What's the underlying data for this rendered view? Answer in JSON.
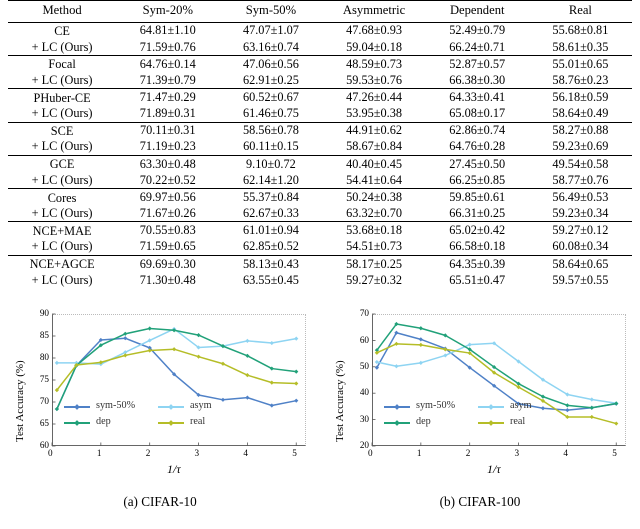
{
  "table": {
    "headers": [
      "Method",
      "Sym-20%",
      "Sym-50%",
      "Asymmetric",
      "Dependent",
      "Real"
    ],
    "groups": [
      {
        "base": {
          "method": "CE",
          "cells": [
            "64.81±1.10",
            "47.07±1.07",
            "47.68±0.93",
            "52.49±0.79",
            "55.68±0.81"
          ],
          "bold": [
            false,
            false,
            false,
            false,
            false
          ]
        },
        "ours": {
          "method": "+ LC (Ours)",
          "cells": [
            "71.59±0.76",
            "63.16±0.74",
            "59.04±0.18",
            "66.24±0.71",
            "58.61±0.35"
          ],
          "bold": [
            true,
            true,
            true,
            true,
            true
          ]
        }
      },
      {
        "base": {
          "method": "Focal",
          "cells": [
            "64.76±0.14",
            "47.06±0.56",
            "48.59±0.73",
            "52.87±0.57",
            "55.01±0.65"
          ],
          "bold": [
            false,
            false,
            false,
            false,
            false
          ]
        },
        "ours": {
          "method": "+ LC (Ours)",
          "cells": [
            "71.39±0.79",
            "62.91±0.25",
            "59.53±0.76",
            "66.38±0.30",
            "58.76±0.23"
          ],
          "bold": [
            true,
            true,
            true,
            true,
            true
          ]
        }
      },
      {
        "base": {
          "method": "PHuber-CE",
          "cells": [
            "71.47±0.29",
            "60.52±0.67",
            "47.26±0.44",
            "64.33±0.41",
            "56.18±0.59"
          ],
          "bold": [
            false,
            false,
            false,
            false,
            false
          ]
        },
        "ours": {
          "method": "+ LC (Ours)",
          "cells": [
            "71.89±0.31",
            "61.46±0.75",
            "53.95±0.38",
            "65.08±0.17",
            "58.64±0.49"
          ],
          "bold": [
            false,
            true,
            true,
            true,
            true
          ]
        }
      },
      {
        "base": {
          "method": "SCE",
          "cells": [
            "70.11±0.31",
            "58.56±0.78",
            "44.91±0.62",
            "62.86±0.74",
            "58.27±0.88"
          ],
          "bold": [
            false,
            false,
            false,
            false,
            false
          ]
        },
        "ours": {
          "method": "+ LC (Ours)",
          "cells": [
            "71.19±0.23",
            "60.11±0.15",
            "58.67±0.84",
            "64.76±0.28",
            "59.23±0.69"
          ],
          "bold": [
            true,
            true,
            true,
            true,
            true
          ]
        }
      },
      {
        "base": {
          "method": "GCE",
          "cells": [
            "63.30±0.48",
            "9.10±0.72",
            "40.40±0.45",
            "27.45±0.50",
            "49.54±0.58"
          ],
          "bold": [
            false,
            false,
            false,
            false,
            false
          ]
        },
        "ours": {
          "method": "+ LC (Ours)",
          "cells": [
            "70.22±0.52",
            "62.14±1.20",
            "54.41±0.64",
            "66.25±0.85",
            "58.77±0.76"
          ],
          "bold": [
            true,
            true,
            true,
            true,
            true
          ]
        }
      },
      {
        "base": {
          "method": "Cores",
          "cells": [
            "69.97±0.56",
            "55.37±0.84",
            "50.24±0.38",
            "59.85±0.61",
            "56.49±0.53"
          ],
          "bold": [
            false,
            false,
            false,
            false,
            false
          ]
        },
        "ours": {
          "method": "+ LC (Ours)",
          "cells": [
            "71.67±0.26",
            "62.67±0.33",
            "63.32±0.70",
            "66.31±0.25",
            "59.23±0.34"
          ],
          "bold": [
            true,
            true,
            true,
            true,
            true
          ]
        }
      },
      {
        "base": {
          "method": "NCE+MAE",
          "cells": [
            "70.55±0.83",
            "61.01±0.94",
            "53.68±0.18",
            "65.02±0.42",
            "59.27±0.12"
          ],
          "bold": [
            false,
            false,
            false,
            false,
            false
          ]
        },
        "ours": {
          "method": "+ LC (Ours)",
          "cells": [
            "71.59±0.65",
            "62.85±0.52",
            "54.51±0.73",
            "66.58±0.18",
            "60.08±0.34"
          ],
          "bold": [
            true,
            true,
            true,
            true,
            true
          ]
        }
      },
      {
        "base": {
          "method": "NCE+AGCE",
          "cells": [
            "69.69±0.30",
            "58.13±0.43",
            "58.17±0.25",
            "64.35±0.39",
            "58.64±0.65"
          ],
          "bold": [
            false,
            false,
            false,
            false,
            false
          ]
        },
        "ours": {
          "method": "+ LC (Ours)",
          "cells": [
            "71.30±0.48",
            "63.55±0.45",
            "59.27±0.32",
            "65.51±0.47",
            "59.57±0.55"
          ],
          "bold": [
            true,
            true,
            true,
            true,
            true
          ]
        }
      }
    ]
  },
  "colors": {
    "sym50": "#4f81c7",
    "asym": "#8ed4f2",
    "dep": "#21a179",
    "real": "#b5bd27"
  },
  "captions": {
    "left": "(a) CIFAR-10",
    "right": "(b) CIFAR-100"
  },
  "chart_data": [
    {
      "type": "line",
      "title": "(a) CIFAR-10",
      "xlabel": "1/τ",
      "ylabel": "Test Accuracy (%)",
      "xlim": [
        0,
        5.2
      ],
      "ylim": [
        60,
        90
      ],
      "xticks": [
        0,
        1,
        2,
        3,
        4,
        5
      ],
      "yticks": [
        60,
        65,
        70,
        75,
        80,
        85,
        90
      ],
      "grid": false,
      "legend_position": "lower-left-inside",
      "x": [
        0.1,
        0.5,
        1.0,
        1.5,
        2.0,
        2.5,
        3.0,
        3.5,
        4.0,
        4.5,
        5.0
      ],
      "series": [
        {
          "name": "sym-50%",
          "color": "#4f81c7",
          "values": [
            68.4,
            78.3,
            84.1,
            84.5,
            82.3,
            76.3,
            71.6,
            70.5,
            71.0,
            69.2,
            70.3
          ]
        },
        {
          "name": "asym",
          "color": "#8ed4f2",
          "values": [
            78.9,
            78.9,
            78.6,
            81.3,
            84.0,
            86.6,
            82.4,
            82.7,
            83.9,
            83.4,
            84.4
          ]
        },
        {
          "name": "dep",
          "color": "#21a179",
          "values": [
            68.4,
            78.3,
            82.9,
            85.5,
            86.7,
            86.3,
            85.2,
            82.7,
            80.5,
            77.6,
            76.9
          ]
        },
        {
          "name": "real",
          "color": "#b5bd27",
          "values": [
            72.7,
            78.4,
            79.0,
            80.6,
            81.7,
            82.0,
            80.3,
            78.7,
            76.1,
            74.4,
            74.2
          ]
        }
      ]
    },
    {
      "type": "line",
      "title": "(b) CIFAR-100",
      "xlabel": "1/τ",
      "ylabel": "Test Accuracy (%)",
      "xlim": [
        0,
        5.2
      ],
      "ylim": [
        20,
        70
      ],
      "xticks": [
        0,
        1,
        2,
        3,
        4,
        5
      ],
      "yticks": [
        20,
        30,
        40,
        50,
        60,
        70
      ],
      "grid": false,
      "legend_position": "lower-left-inside",
      "x": [
        0.1,
        0.5,
        1.0,
        1.5,
        2.0,
        2.5,
        3.0,
        3.5,
        4.0,
        4.5,
        5.0
      ],
      "series": [
        {
          "name": "sym-50%",
          "color": "#4f81c7",
          "values": [
            49.7,
            62.9,
            60.4,
            56.9,
            49.7,
            42.8,
            36.0,
            34.3,
            33.6,
            34.5,
            36.0
          ]
        },
        {
          "name": "asym",
          "color": "#8ed4f2",
          "values": [
            51.8,
            50.2,
            51.5,
            54.3,
            58.4,
            58.9,
            52.0,
            45.1,
            39.5,
            37.6,
            36.2
          ]
        },
        {
          "name": "dep",
          "color": "#21a179",
          "values": [
            56.3,
            66.2,
            64.6,
            61.9,
            56.6,
            49.9,
            43.6,
            38.7,
            35.4,
            34.5,
            36.1
          ]
        },
        {
          "name": "real",
          "color": "#b5bd27",
          "values": [
            55.3,
            58.7,
            58.3,
            56.6,
            55.2,
            47.8,
            42.3,
            37.1,
            31.0,
            31.0,
            28.5
          ]
        }
      ]
    }
  ],
  "legend": {
    "entries": [
      "sym-50%",
      "asym",
      "dep",
      "real"
    ]
  }
}
